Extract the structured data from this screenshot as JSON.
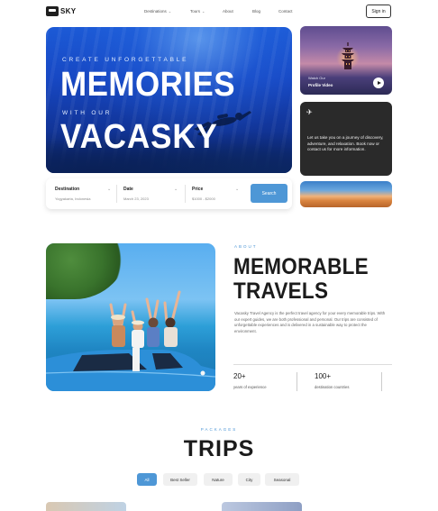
{
  "brand": {
    "name": "SKY"
  },
  "nav": {
    "items": [
      {
        "label": "Destinations",
        "has_dropdown": true
      },
      {
        "label": "Tours",
        "has_dropdown": true
      },
      {
        "label": "About",
        "has_dropdown": false
      },
      {
        "label": "Blog",
        "has_dropdown": false
      },
      {
        "label": "Contact",
        "has_dropdown": false
      }
    ],
    "signin_label": "Sign in"
  },
  "hero": {
    "kicker_top": "CREATE UNFORGETTABLE",
    "headline_top": "MEMORIES",
    "kicker_bottom": "WITH OUR",
    "headline_bottom": "VACASKY"
  },
  "search": {
    "fields": [
      {
        "label": "Destination",
        "value": "Yogyakarta, Indonesia"
      },
      {
        "label": "Date",
        "value": "March 23, 2023"
      },
      {
        "label": "Price",
        "value": "$1000 - $2000"
      }
    ],
    "button_label": "Search"
  },
  "video_card": {
    "line1": "Watch Our",
    "line2": "Profile Video"
  },
  "info_card": {
    "text": "Let us take you on a journey of discovery, adventure, and relaxation. Book now or contact us for more information."
  },
  "about": {
    "kicker": "ABOUT",
    "title_line1": "MEMORABLE",
    "title_line2": "TRAVELS",
    "description": "Vacasky Travel Agency is the perfect travel agency for your every memorable trips. With our expert guides, we are both professional and personal. Our trips are consisted of unforgettable experiences and is delivered in a sustainable way to protect the environment.",
    "stats": [
      {
        "value": "20+",
        "label": "years of experience"
      },
      {
        "value": "100+",
        "label": "destination countries"
      }
    ]
  },
  "packages": {
    "kicker": "PACKAGES",
    "title": "TRIPS",
    "filters": [
      "All",
      "Best Seller",
      "Nature",
      "City",
      "Seasonal"
    ],
    "active_filter": "All"
  },
  "colors": {
    "accent": "#4e97d6",
    "text_dark": "#1b1b1b",
    "card_dark": "#2a2a2a"
  }
}
